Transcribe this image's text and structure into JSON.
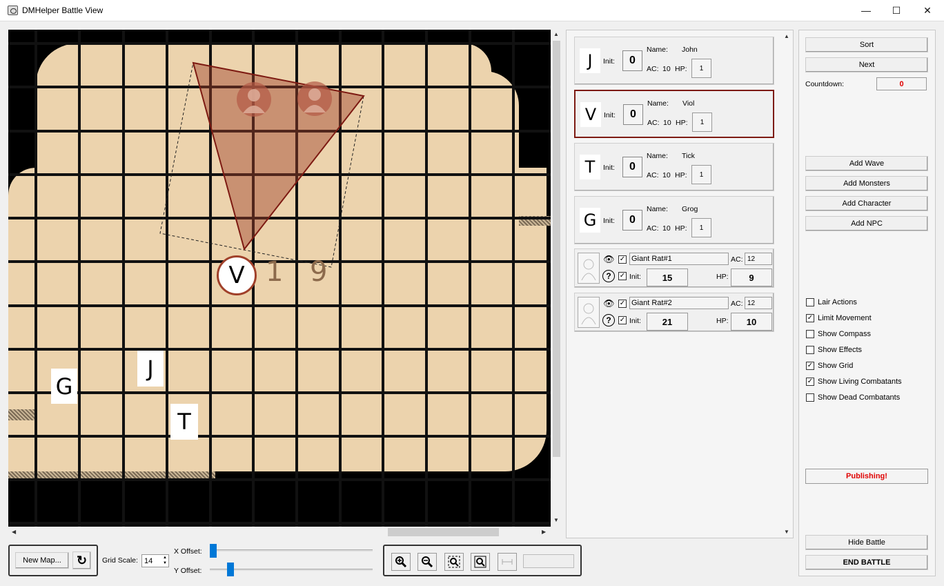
{
  "window": {
    "title": "DMHelper Battle View",
    "minimize": "—",
    "maximize": "☐",
    "close": "✕"
  },
  "map": {
    "tokens": [
      {
        "letter": "G"
      },
      {
        "letter": "J"
      },
      {
        "letter": "T"
      },
      {
        "letter": "V"
      }
    ],
    "distance_label": [
      "1",
      "9"
    ]
  },
  "combatants": [
    {
      "letter": "J",
      "init_label": "Init:",
      "init": "0",
      "name_label": "Name:",
      "name": "John",
      "ac_label": "AC:",
      "ac": "10",
      "hp_label": "HP:",
      "hp": "1",
      "active": false
    },
    {
      "letter": "V",
      "init_label": "Init:",
      "init": "0",
      "name_label": "Name:",
      "name": "Viol",
      "ac_label": "AC:",
      "ac": "10",
      "hp_label": "HP:",
      "hp": "1",
      "active": true
    },
    {
      "letter": "T",
      "init_label": "Init:",
      "init": "0",
      "name_label": "Name:",
      "name": "Tick",
      "ac_label": "AC:",
      "ac": "10",
      "hp_label": "HP:",
      "hp": "1",
      "active": false
    },
    {
      "letter": "G",
      "init_label": "Init:",
      "init": "0",
      "name_label": "Name:",
      "name": "Grog",
      "ac_label": "AC:",
      "ac": "10",
      "hp_label": "HP:",
      "hp": "1",
      "active": false
    }
  ],
  "monsters": [
    {
      "name": "Giant Rat#1",
      "ac_label": "AC:",
      "ac": "12",
      "init_label": "Init:",
      "init": "15",
      "hp_label": "HP:",
      "hp": "9",
      "visible": true,
      "known": true
    },
    {
      "name": "Giant Rat#2",
      "ac_label": "AC:",
      "ac": "12",
      "init_label": "Init:",
      "init": "21",
      "hp_label": "HP:",
      "hp": "10",
      "visible": true,
      "known": true
    }
  ],
  "controls": {
    "sort": "Sort",
    "next": "Next",
    "countdown_label": "Countdown:",
    "countdown_value": "0",
    "add_wave": "Add Wave",
    "add_monsters": "Add Monsters",
    "add_character": "Add Character",
    "add_npc": "Add NPC",
    "options": [
      {
        "label": "Lair Actions",
        "checked": false
      },
      {
        "label": "Limit Movement",
        "checked": true
      },
      {
        "label": "Show Compass",
        "checked": false
      },
      {
        "label": "Show Effects",
        "checked": false
      },
      {
        "label": "Show Grid",
        "checked": true
      },
      {
        "label": "Show Living Combatants",
        "checked": true
      },
      {
        "label": "Show Dead Combatants",
        "checked": false
      }
    ],
    "publishing": "Publishing!",
    "hide_battle": "Hide Battle",
    "end_battle": "END BATTLE"
  },
  "bottom": {
    "new_map": "New Map...",
    "refresh_icon": "↻",
    "grid_scale_label": "Grid Scale:",
    "grid_scale": "14",
    "x_offset_label": "X Offset:",
    "y_offset_label": "Y Offset:",
    "x_offset_fraction": 0.0,
    "y_offset_fraction": 0.11
  },
  "colors": {
    "accent": "#0078d7",
    "active_border": "#7d1a12",
    "alert": "#e00000",
    "template": "#a0402a"
  }
}
